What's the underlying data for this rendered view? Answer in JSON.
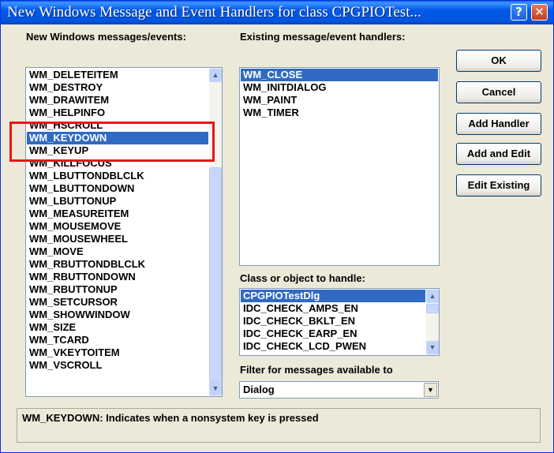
{
  "window": {
    "title": "New Windows Message and Event Handlers for class CPGPIOTest..."
  },
  "labels": {
    "messages_events": "New Windows messages/events:",
    "existing_handlers": "Existing message/event handlers:",
    "class_object": "Class or object to handle:",
    "filter": "Filter for messages available to"
  },
  "messages_list": {
    "items": [
      "WM_DELETEITEM",
      "WM_DESTROY",
      "WM_DRAWITEM",
      "WM_HELPINFO",
      "WM_HSCROLL",
      "WM_KEYDOWN",
      "WM_KEYUP",
      "WM_KILLFOCUS",
      "WM_LBUTTONDBLCLK",
      "WM_LBUTTONDOWN",
      "WM_LBUTTONUP",
      "WM_MEASUREITEM",
      "WM_MOUSEMOVE",
      "WM_MOUSEWHEEL",
      "WM_MOVE",
      "WM_RBUTTONDBLCLK",
      "WM_RBUTTONDOWN",
      "WM_RBUTTONUP",
      "WM_SETCURSOR",
      "WM_SHOWWINDOW",
      "WM_SIZE",
      "WM_TCARD",
      "WM_VKEYTOITEM",
      "WM_VSCROLL"
    ],
    "selected": "WM_KEYDOWN"
  },
  "existing_list": {
    "items": [
      "WM_CLOSE",
      "WM_INITDIALOG",
      "WM_PAINT",
      "WM_TIMER"
    ],
    "selected": "WM_CLOSE"
  },
  "class_list": {
    "items": [
      "CPGPIOTestDlg",
      "IDC_CHECK_AMPS_EN",
      "IDC_CHECK_BKLT_EN",
      "IDC_CHECK_EARP_EN",
      "IDC_CHECK_LCD_PWEN"
    ],
    "selected": "CPGPIOTestDlg"
  },
  "filter_combo": {
    "value": "Dialog"
  },
  "buttons": {
    "ok": "OK",
    "cancel": "Cancel",
    "add_handler": "Add Handler",
    "add_and_edit": "Add and Edit",
    "edit_existing": "Edit Existing"
  },
  "description": "WM_KEYDOWN:  Indicates when a nonsystem key is pressed",
  "colors": {
    "selection": "#316ac5",
    "annotation": "#e8151b",
    "titlebar": "#0058e6"
  }
}
